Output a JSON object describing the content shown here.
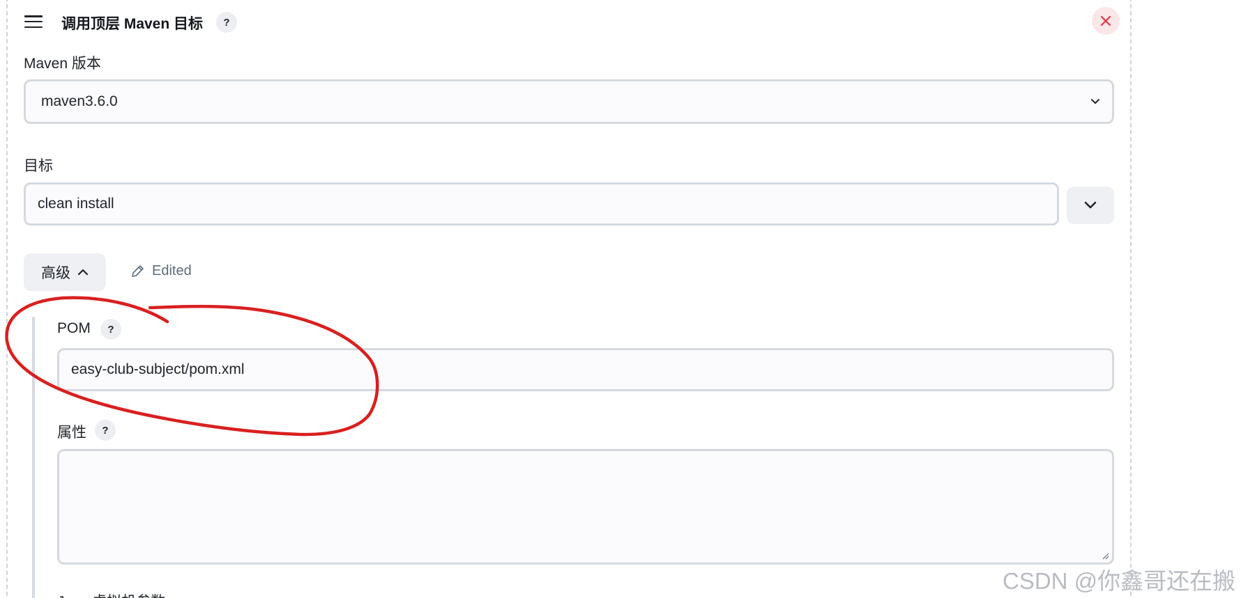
{
  "header": {
    "title": "调用顶层 Maven 目标",
    "help_label": "?",
    "close_label": "×"
  },
  "maven_version": {
    "label": "Maven 版本",
    "selected": "maven3.6.0"
  },
  "goals": {
    "label": "目标",
    "value": "clean install"
  },
  "advanced": {
    "label": "高级",
    "edited_label": "Edited"
  },
  "pom": {
    "label": "POM",
    "help_label": "?",
    "value": "easy-club-subject/pom.xml"
  },
  "properties": {
    "label": "属性",
    "help_label": "?",
    "value": ""
  },
  "jvm_options": {
    "label": "Java 虚拟机参数"
  },
  "watermark": "CSDN @你鑫哥还在搬",
  "colors": {
    "annotation_red": "#d92020",
    "close_red": "#e0344a",
    "input_border": "#d5d9df"
  },
  "icons": {
    "drag": "hamburger-icon",
    "close": "close-icon",
    "chevron": "chevron-down-icon",
    "edit": "pencil-icon"
  }
}
